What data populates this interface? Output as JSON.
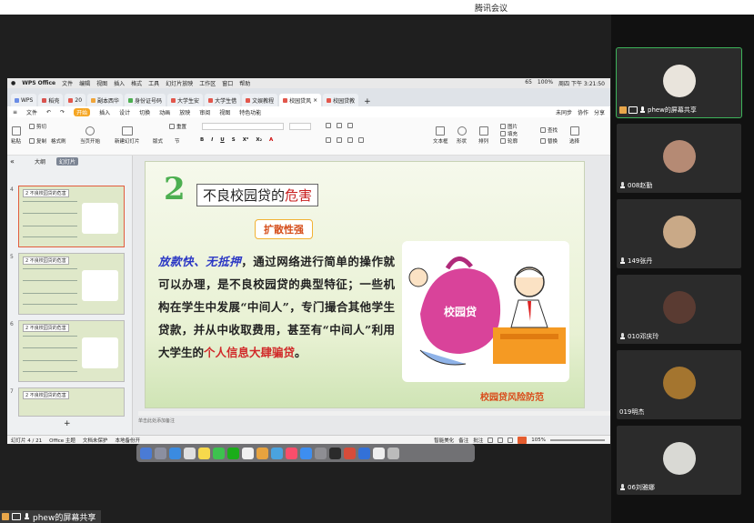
{
  "app_title": "腾讯会议",
  "mac_menubar": {
    "app_name": "WPS Office",
    "items": [
      "文件",
      "编辑",
      "视图",
      "插入",
      "格式",
      "工具",
      "幻灯片放映",
      "工作区",
      "窗口",
      "帮助"
    ],
    "right": [
      "65",
      "100%",
      "周四 下午 3:21:50"
    ]
  },
  "tabs": [
    {
      "label": "WPS",
      "color": "#6b8de6"
    },
    {
      "label": "稻壳",
      "color": "#d9534f"
    },
    {
      "label": "20",
      "color": "#e2574c"
    },
    {
      "label": "副本西华",
      "color": "#f0a53a"
    },
    {
      "label": "身份证号码",
      "color": "#4caf50"
    },
    {
      "label": "大学生安",
      "color": "#e2574c"
    },
    {
      "label": "大学生借",
      "color": "#e2574c"
    },
    {
      "label": "文娱教程",
      "color": "#e2574c"
    },
    {
      "label": "校园贷风",
      "color": "#e2574c",
      "active": true
    },
    {
      "label": "校园贷教",
      "color": "#e2574c"
    }
  ],
  "menu": {
    "file": "文件",
    "start": "开始",
    "items": [
      "插入",
      "设计",
      "切换",
      "动画",
      "放映",
      "审阅",
      "视图",
      "特色功能"
    ],
    "right": [
      "未同步",
      "协作",
      "分享"
    ]
  },
  "ribbon": {
    "paste": "粘贴",
    "cut": "剪切",
    "copy": "复制",
    "format_painter": "格式刷",
    "from_current": "当页开始",
    "new_slide": "新建幻灯片",
    "layout": "版式",
    "section": "节",
    "reset": "重置",
    "textbox": "文本框",
    "shape": "形状",
    "arrange": "排列",
    "image": "图片",
    "fill": "填充",
    "outline": "轮廓",
    "find": "查找",
    "replace": "替换",
    "select": "选择"
  },
  "thumbs": {
    "tab_outline": "大纲",
    "tab_slides": "幻灯片",
    "items": [
      {
        "num": "4",
        "title": "2 不良校园贷的危害"
      },
      {
        "num": "5",
        "title": "2 不良校园贷的危害"
      },
      {
        "num": "6",
        "title": "2 不良校园贷的危害"
      },
      {
        "num": "7",
        "title": "2 不良校园贷的危害"
      }
    ],
    "add": "+"
  },
  "slide": {
    "number": "2",
    "title_a": "不良校园贷的",
    "title_b": "危害",
    "badge": "扩散性强",
    "body_blue": "放款快、无抵押",
    "body_1": "，通过网络进行简单的操作就可以办理，是不良校园贷的典型特征；一些机构在学生中发展“中间人”，专门撮合其他学生贷款，并从中收取费用，甚至有“中间人”利用大学生的",
    "body_red": "个人信息大肆骗贷",
    "body_end": "。",
    "bag_label": "校园贷",
    "footer": "校园贷风险防范"
  },
  "notes": "单击此处添加备注",
  "statusbar": {
    "slide": "幻灯片 4 / 21",
    "theme": "Office 主题",
    "protect": "文档未保护",
    "backup": "本地备份开",
    "beautify": "智能美化",
    "notes": "备注",
    "comment": "批注",
    "zoom": "105%"
  },
  "participants": [
    {
      "name": "phew的屏幕共享",
      "active": true,
      "avatar_color": "#e9e4dc"
    },
    {
      "name": "008赵勤",
      "avatar_color": "#b58a74"
    },
    {
      "name": "149张丹",
      "avatar_color": "#c9a987"
    },
    {
      "name": "010邓庆玲",
      "avatar_color": "#5a3b32"
    },
    {
      "name": "019明杰",
      "avatar_color": "#a4752f"
    },
    {
      "name": "06刘雅娜",
      "avatar_color": "#d9d9d4"
    }
  ],
  "host_label": "phew的屏幕共享"
}
